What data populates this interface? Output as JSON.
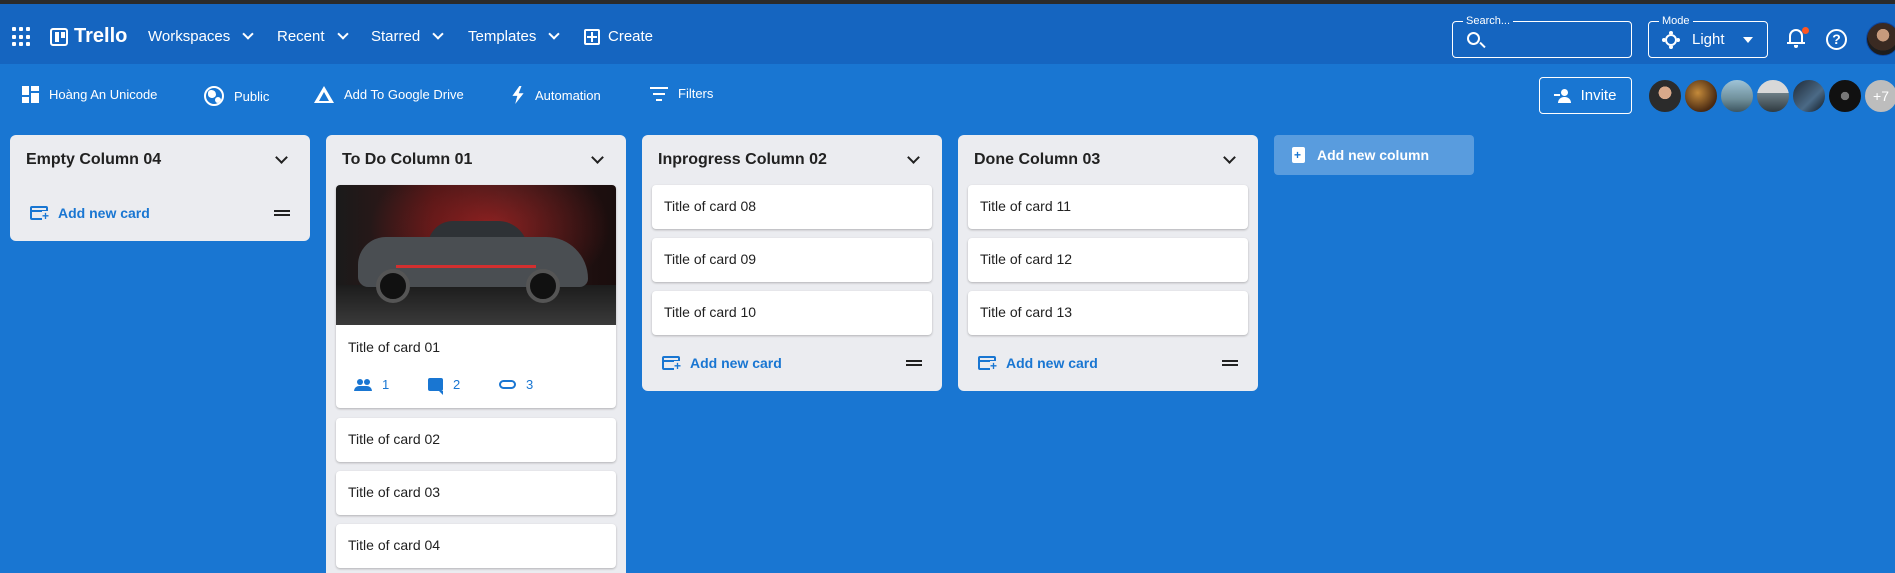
{
  "appbar": {
    "brand": "Trello",
    "menus": [
      "Workspaces",
      "Recent",
      "Starred",
      "Templates"
    ],
    "create_label": "Create",
    "search": {
      "label": "Search...",
      "value": ""
    },
    "mode": {
      "label": "Mode",
      "value": "Light"
    },
    "notification_dot_color": "#ff5722"
  },
  "boardbar": {
    "board_name": "Hoàng An Unicode",
    "visibility": "Public",
    "drive_label": "Add To Google Drive",
    "automation_label": "Automation",
    "filters_label": "Filters",
    "invite_label": "Invite",
    "more_members": "+7"
  },
  "board": {
    "add_card_label": "Add new card",
    "add_column_label": "Add new column",
    "columns": [
      {
        "title": "Empty Column 04",
        "cards": []
      },
      {
        "title": "To Do Column 01",
        "cards": [
          {
            "title": "Title of card 01",
            "has_cover": true,
            "members": "1",
            "comments": "2",
            "attachments": "3"
          },
          {
            "title": "Title of card 02"
          },
          {
            "title": "Title of card 03"
          },
          {
            "title": "Title of card 04"
          }
        ]
      },
      {
        "title": "Inprogress Column 02",
        "cards": [
          {
            "title": "Title of card 08"
          },
          {
            "title": "Title of card 09"
          },
          {
            "title": "Title of card 10"
          }
        ]
      },
      {
        "title": "Done Column 03",
        "cards": [
          {
            "title": "Title of card 11"
          },
          {
            "title": "Title of card 12"
          },
          {
            "title": "Title of card 13"
          }
        ]
      }
    ]
  },
  "colors": {
    "appbar": "#1565c0",
    "board_bg": "#1976d2",
    "column_bg": "#ebecf0",
    "accent": "#1976d2"
  }
}
